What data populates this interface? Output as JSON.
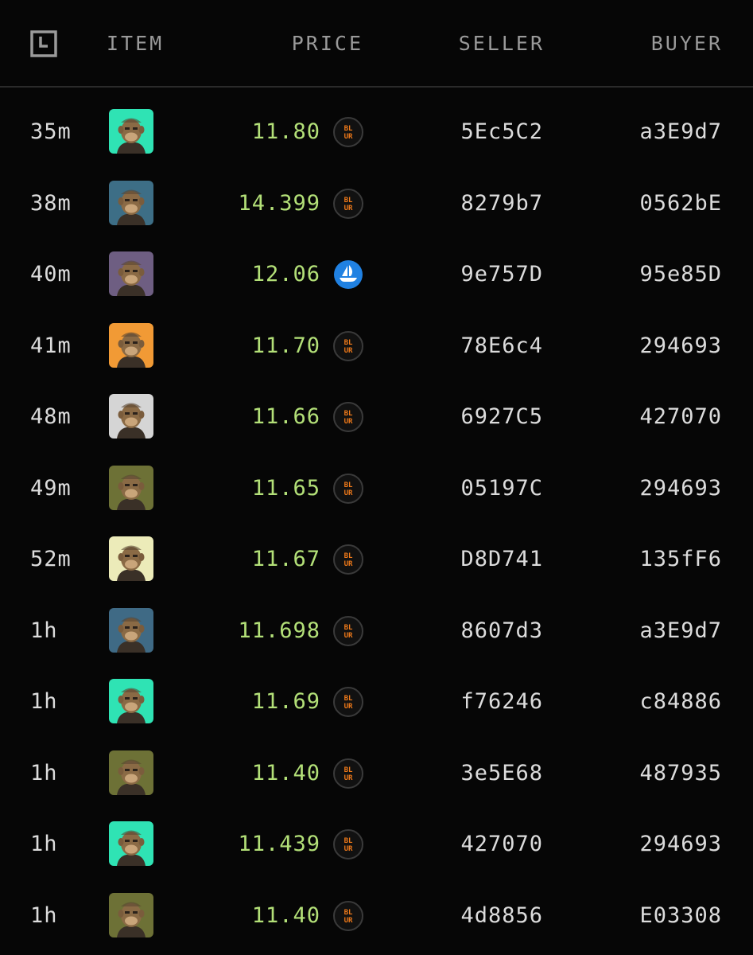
{
  "header": {
    "time_icon": "clock-icon",
    "item": "ITEM",
    "price": "PRICE",
    "seller": "SELLER",
    "buyer": "BUYER"
  },
  "colors": {
    "background": "#060606",
    "price_green": "#b3e078",
    "header_gray": "#9a9a9a",
    "blur_orange": "#f07a1a",
    "opensea_blue": "#2081e2"
  },
  "sales": [
    {
      "time": "35m",
      "price": "11.80",
      "marketplace": "blur",
      "seller": "5Ec5C2",
      "buyer": "a3E9d7",
      "bg": "#2fe3b4"
    },
    {
      "time": "38m",
      "price": "14.399",
      "marketplace": "blur",
      "seller": "8279b7",
      "buyer": "0562bE",
      "bg": "#3d6e86"
    },
    {
      "time": "40m",
      "price": "12.06",
      "marketplace": "opensea",
      "seller": "9e757D",
      "buyer": "95e85D",
      "bg": "#6e5e82"
    },
    {
      "time": "41m",
      "price": "11.70",
      "marketplace": "blur",
      "seller": "78E6c4",
      "buyer": "294693",
      "bg": "#f19a35"
    },
    {
      "time": "48m",
      "price": "11.66",
      "marketplace": "blur",
      "seller": "6927C5",
      "buyer": "427070",
      "bg": "#d5d5d5"
    },
    {
      "time": "49m",
      "price": "11.65",
      "marketplace": "blur",
      "seller": "05197C",
      "buyer": "294693",
      "bg": "#6d7136"
    },
    {
      "time": "52m",
      "price": "11.67",
      "marketplace": "blur",
      "seller": "D8D741",
      "buyer": "135fF6",
      "bg": "#ecebb9"
    },
    {
      "time": "1h",
      "price": "11.698",
      "marketplace": "blur",
      "seller": "8607d3",
      "buyer": "a3E9d7",
      "bg": "#3f6a85"
    },
    {
      "time": "1h",
      "price": "11.69",
      "marketplace": "blur",
      "seller": "f76246",
      "buyer": "c84886",
      "bg": "#2fe3b4"
    },
    {
      "time": "1h",
      "price": "11.40",
      "marketplace": "blur",
      "seller": "3e5E68",
      "buyer": "487935",
      "bg": "#6d7136"
    },
    {
      "time": "1h",
      "price": "11.439",
      "marketplace": "blur",
      "seller": "427070",
      "buyer": "294693",
      "bg": "#2fe3b4"
    },
    {
      "time": "1h",
      "price": "11.40",
      "marketplace": "blur",
      "seller": "4d8856",
      "buyer": "E03308",
      "bg": "#6d7136"
    }
  ]
}
